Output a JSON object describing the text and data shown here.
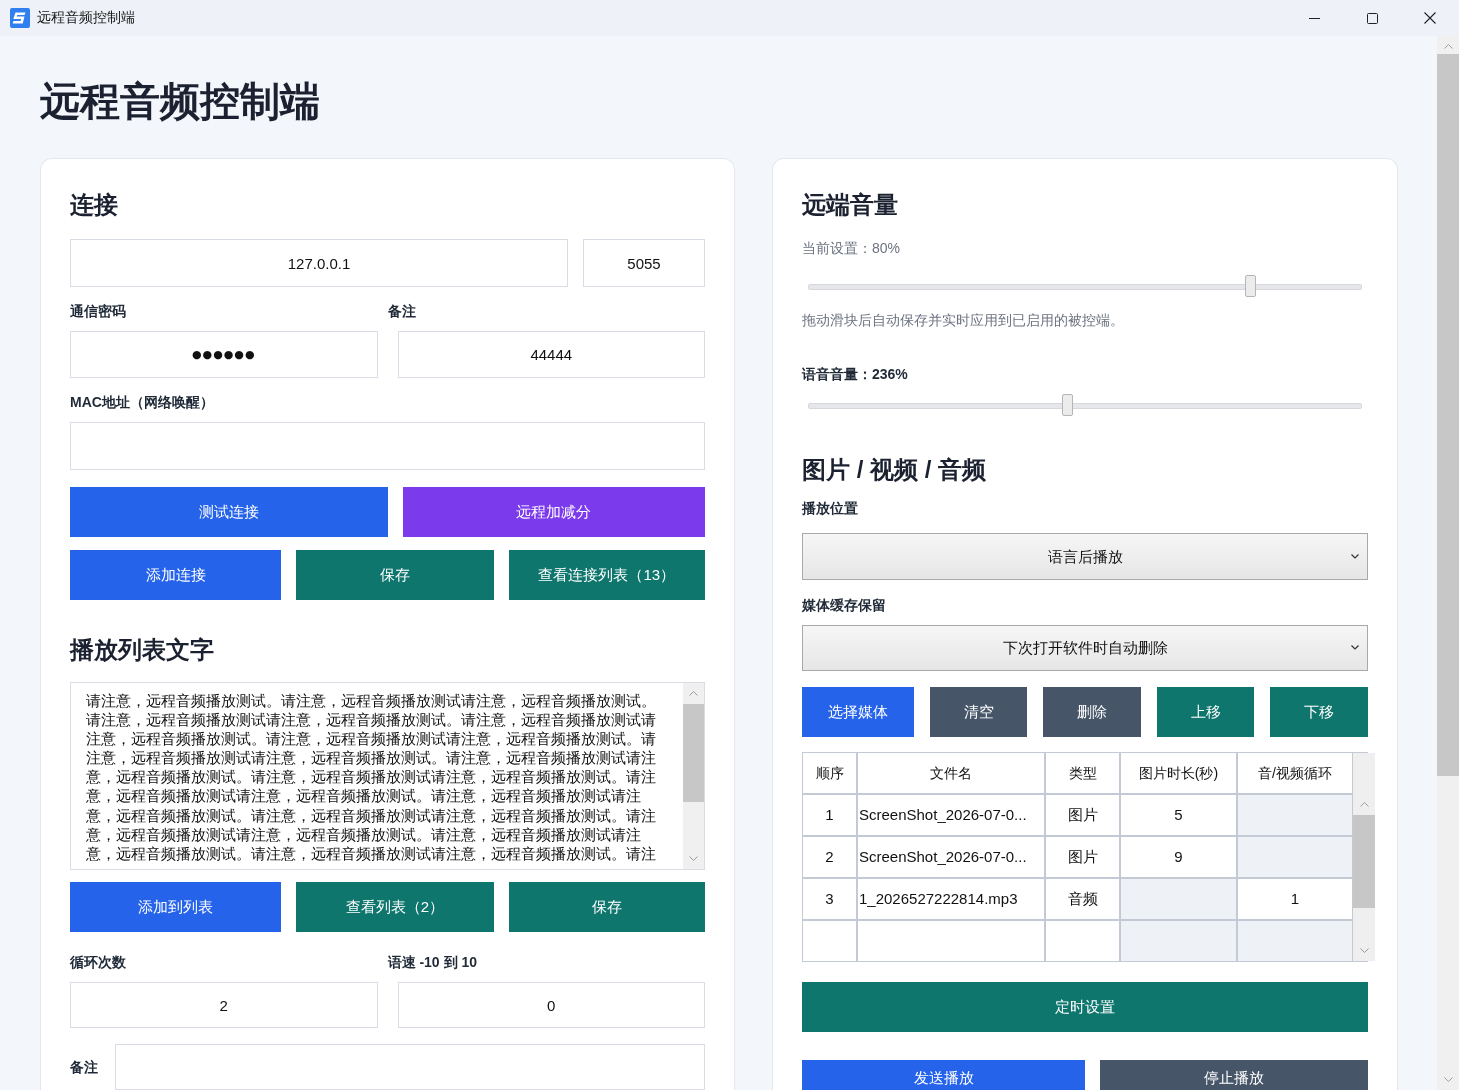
{
  "window": {
    "title": "远程音频控制端"
  },
  "heading": "远程音频控制端",
  "connection": {
    "heading": "连接",
    "host": {
      "value": "127.0.0.1"
    },
    "port": {
      "value": "5055"
    },
    "password": {
      "label": "通信密码",
      "value": "●●●●●●"
    },
    "note": {
      "label": "备注",
      "value": "44444"
    },
    "mac_address": {
      "label": "MAC地址（网络唤醒）"
    },
    "button_rows": [
      [
        {
          "label": "测试连接",
          "kind": "primary"
        },
        {
          "label": "远程加减分",
          "kind": "special"
        }
      ],
      [
        {
          "label": "添加连接",
          "kind": "primary"
        },
        {
          "label": "保存",
          "kind": "confirm"
        },
        {
          "label": "查看连接列表（13）",
          "kind": "confirm"
        }
      ]
    ]
  },
  "playlist_text": {
    "heading": "播放列表文字",
    "lines": [
      "请注意，远程音频播放测试。请注意，远程音频播放测试请注意，远程音频播放测试。",
      "请注意，远程音频播放测试请注意，远程音频播放测试。请注意，远程音频播放测试请",
      "注意，远程音频播放测试。请注意，远程音频播放测试请注意，远程音频播放测试。请",
      "注意，远程音频播放测试请注意，远程音频播放测试。请注意，远程音频播放测试请注",
      "意，远程音频播放测试。请注意，远程音频播放测试请注意，远程音频播放测试。请注",
      "意，远程音频播放测试请注意，远程音频播放测试。请注意，远程音频播放测试请注",
      "意，远程音频播放测试。请注意，远程音频播放测试请注意，远程音频播放测试。请注",
      "意，远程音频播放测试请注意，远程音频播放测试。请注意，远程音频播放测试请注",
      "意，远程音频播放测试。请注意，远程音频播放测试请注意，远程音频播放测试。请注"
    ],
    "buttons": [
      {
        "label": "添加到列表",
        "kind": "primary"
      },
      {
        "label": "查看列表（2）",
        "kind": "confirm"
      },
      {
        "label": "保存",
        "kind": "confirm"
      }
    ]
  },
  "playback_settings": {
    "loop_count": {
      "label": "循环次数",
      "value": "2"
    },
    "speech_rate": {
      "label": "语速 -10 到 10",
      "value": "0"
    },
    "remark": {
      "label": "备注"
    }
  },
  "remote_volume": {
    "heading": "远端音量",
    "master": {
      "reading": "当前设置：80%",
      "level": 0.8
    },
    "hint": "拖动滑块后自动保存并实时应用到已启用的被控端。",
    "voice": {
      "reading": "语音音量：236%",
      "level": 0.47
    }
  },
  "media": {
    "heading": "图片 / 视频 / 音频",
    "play_position": {
      "label": "播放位置",
      "value": "语言后播放"
    },
    "cache_retention": {
      "label": "媒体缓存保留",
      "value": "下次打开软件时自动删除"
    },
    "buttons": [
      {
        "label": "选择媒体",
        "kind": "primary"
      },
      {
        "label": "清空",
        "kind": "neutral"
      },
      {
        "label": "删除",
        "kind": "neutral"
      },
      {
        "label": "上移",
        "kind": "confirm"
      },
      {
        "label": "下移",
        "kind": "confirm"
      }
    ],
    "table": {
      "columns": [
        "顺序",
        "文件名",
        "类型",
        "图片时长(秒)",
        "音/视频循环"
      ],
      "rows": [
        {
          "cells": [
            {
              "text": "1",
              "disabled": false
            },
            {
              "text": "ScreenShot_2026-07-0...",
              "disabled": false
            },
            {
              "text": "图片",
              "disabled": false
            },
            {
              "text": "5",
              "disabled": false
            },
            {
              "disabled": true
            }
          ]
        },
        {
          "cells": [
            {
              "text": "2",
              "disabled": false
            },
            {
              "text": "ScreenShot_2026-07-0...",
              "disabled": false
            },
            {
              "text": "图片",
              "disabled": false
            },
            {
              "text": "9",
              "disabled": false
            },
            {
              "disabled": true
            }
          ]
        },
        {
          "cells": [
            {
              "text": "3",
              "disabled": false
            },
            {
              "text": "1_2026527222814.mp3",
              "disabled": false
            },
            {
              "text": "音频",
              "disabled": false
            },
            {
              "disabled": true
            },
            {
              "text": "1",
              "disabled": false
            }
          ]
        },
        {
          "cells": [
            {
              "disabled": false
            },
            {
              "disabled": false
            },
            {
              "disabled": false
            },
            {
              "disabled": true
            },
            {
              "disabled": true
            }
          ]
        }
      ]
    },
    "schedule_button": {
      "label": "定时设置",
      "kind": "confirm"
    },
    "bottom_buttons": [
      {
        "label": "发送播放",
        "kind": "primary"
      },
      {
        "label": "停止播放",
        "kind": "neutral"
      }
    ]
  }
}
